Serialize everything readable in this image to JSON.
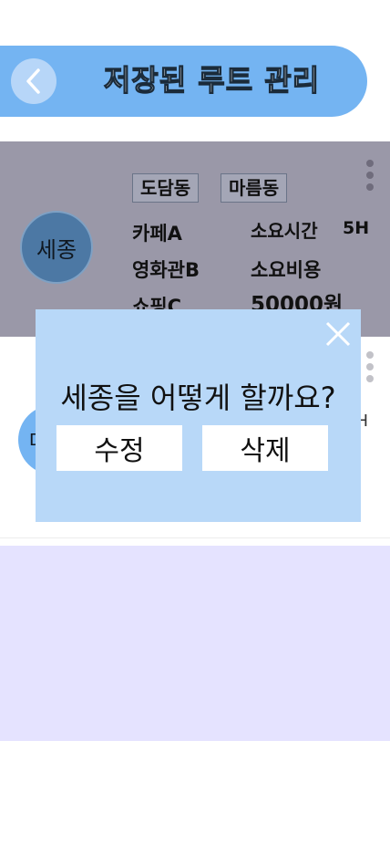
{
  "header": {
    "title": "저장된 루트 관리",
    "back_icon": "chevron-left-icon"
  },
  "route1": {
    "name": "세종",
    "tags": [
      "도담동",
      "마름동"
    ],
    "places": [
      "카페A",
      "영화관B",
      "쇼핑C"
    ],
    "time_label": "소요시간",
    "time_value": "5H",
    "cost_label": "소요비용",
    "cost_value": "50000원"
  },
  "route2": {
    "name_fragment": "대",
    "info_fragment": "H"
  },
  "modal": {
    "question": "세종을 어떻게 할까요?",
    "edit_label": "수정",
    "delete_label": "삭제",
    "close_icon": "close-icon"
  },
  "colors": {
    "header_bg": "#74b4f2",
    "card1_bg": "#9a98a8",
    "card3_bg": "#e5e3ff",
    "modal_bg": "#b8d8f8",
    "avatar1_bg": "#4c78a4"
  }
}
